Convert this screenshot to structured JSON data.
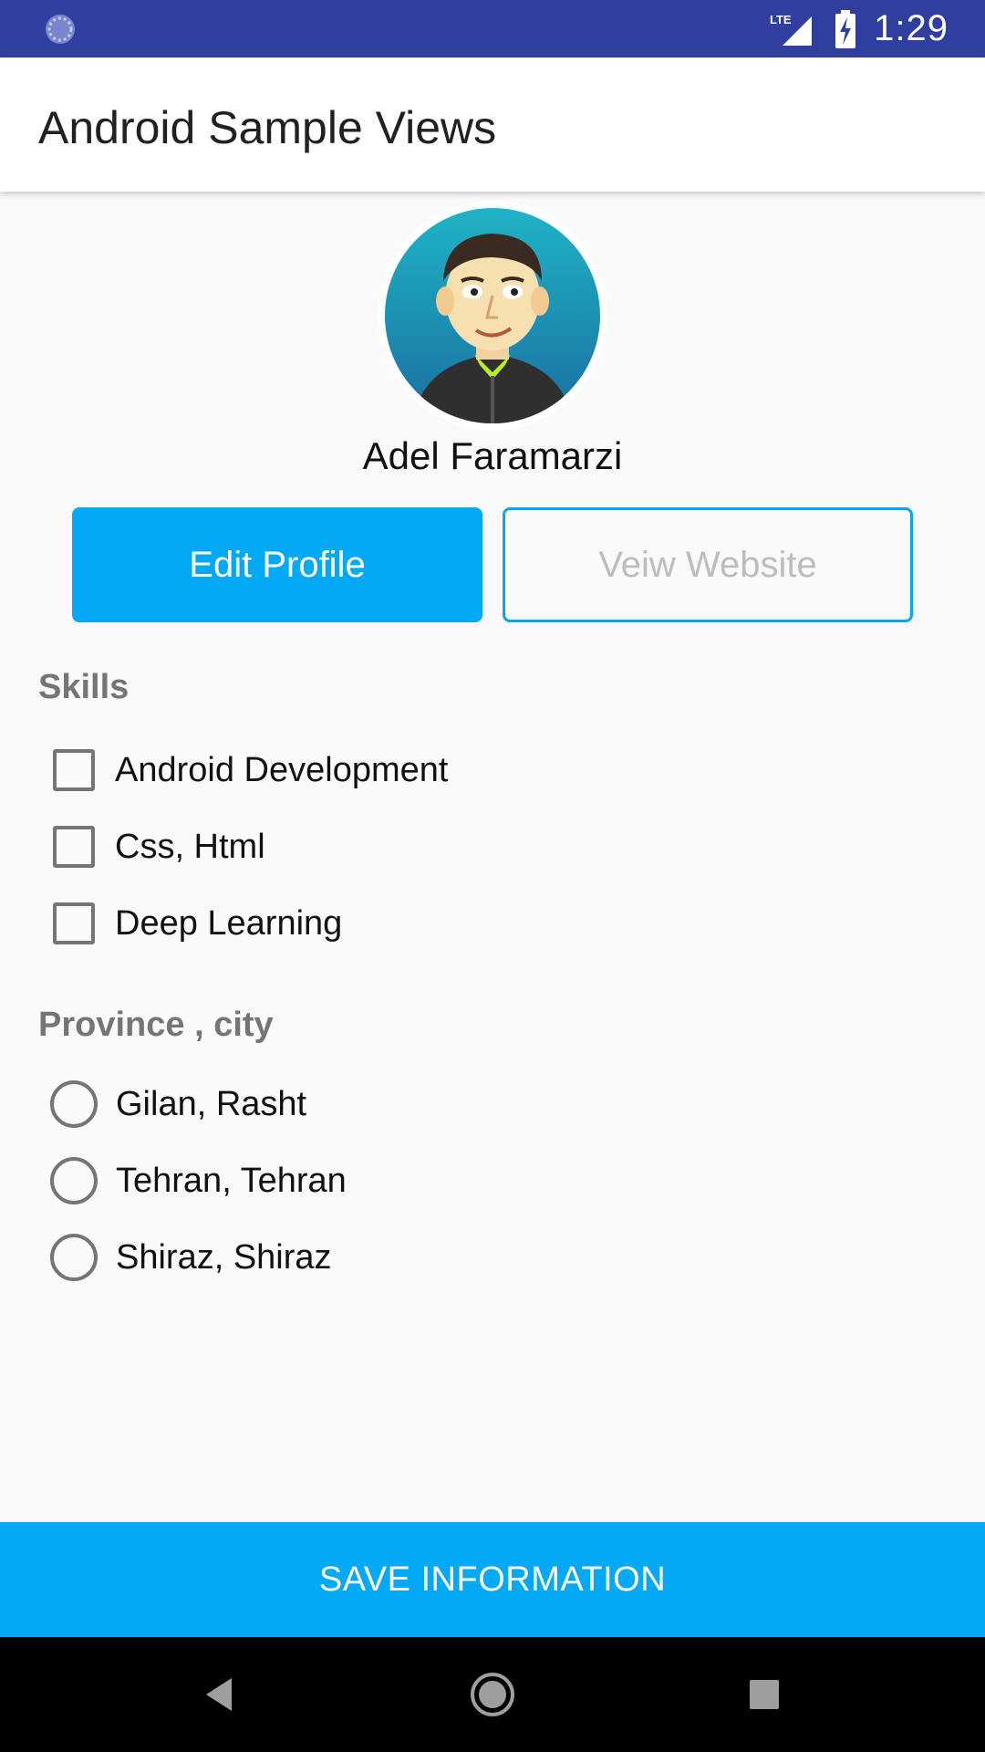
{
  "status_bar": {
    "time": "1:29",
    "network": "LTE",
    "icons": [
      "loading-icon",
      "signal-icon",
      "battery-charging-icon"
    ]
  },
  "app_bar": {
    "title": "Android Sample Views"
  },
  "profile": {
    "name": "Adel Faramarzi",
    "avatar_icon": "avatar-cartoon-icon"
  },
  "buttons": {
    "edit_profile": "Edit Profile",
    "view_website": "Veiw Website"
  },
  "skills": {
    "title": "Skills",
    "items": [
      {
        "label": "Android Development",
        "checked": false
      },
      {
        "label": "Css, Html",
        "checked": false
      },
      {
        "label": "Deep Learning",
        "checked": false
      }
    ]
  },
  "province": {
    "title": "Province , city",
    "items": [
      {
        "label": "Gilan, Rasht",
        "selected": false
      },
      {
        "label": "Tehran, Tehran",
        "selected": false
      },
      {
        "label": "Shiraz, Shiraz",
        "selected": false
      }
    ]
  },
  "save_button": "SAVE INFORMATION",
  "nav_bar": {
    "icons": [
      "back-icon",
      "home-icon",
      "recents-icon"
    ]
  },
  "colors": {
    "status_bar": "#303f9f",
    "accent": "#03a9f4",
    "section_title": "#757575"
  }
}
